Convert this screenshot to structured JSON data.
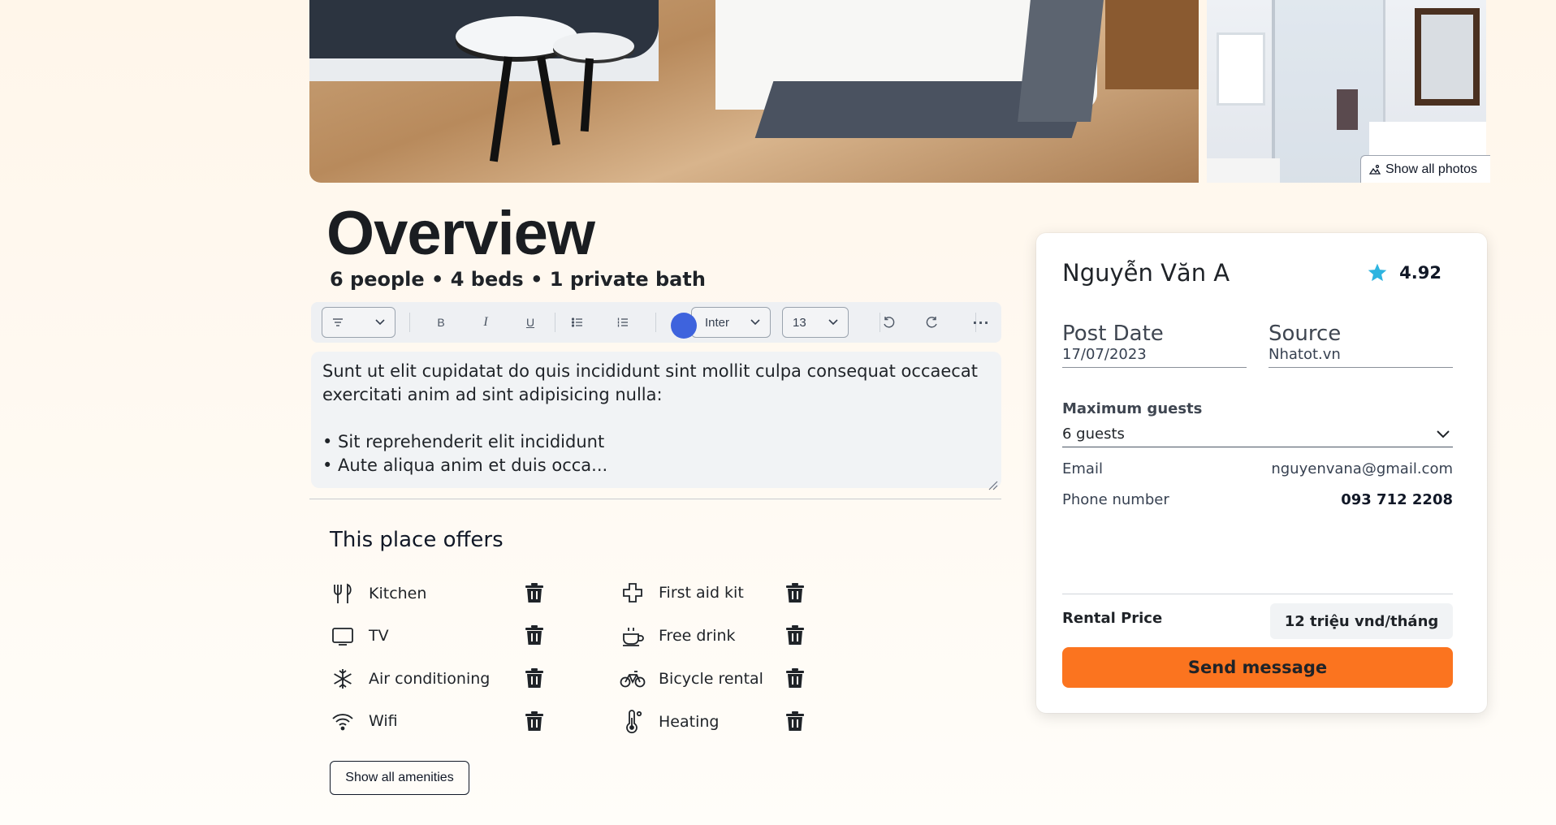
{
  "gallery": {
    "show_all_photos_label": "Show all photos"
  },
  "overview": {
    "title": "Overview",
    "subtitle": "6 people • 4 beds • 1 private bath"
  },
  "toolbar": {
    "font_family": "Inter",
    "font_size": "13"
  },
  "editor": {
    "content": "Sunt ut elit cupidatat do quis incididunt sint mollit culpa consequat occaecat exercitati anim ad sint adipisicing nulla:\n\n• Sit reprehenderit elit incididunt\n• Aute aliqua anim et duis occa..."
  },
  "amenities": {
    "title": "This place offers",
    "items": [
      {
        "label": "Kitchen",
        "icon": "utensils-icon"
      },
      {
        "label": "First aid kit",
        "icon": "first-aid-icon"
      },
      {
        "label": "TV",
        "icon": "tv-icon"
      },
      {
        "label": "Free drink",
        "icon": "coffee-icon"
      },
      {
        "label": "Air conditioning",
        "icon": "snowflake-icon"
      },
      {
        "label": "Bicycle rental",
        "icon": "bicycle-icon"
      },
      {
        "label": "Wifi",
        "icon": "wifi-icon"
      },
      {
        "label": "Heating",
        "icon": "thermometer-icon"
      }
    ],
    "show_all_label": "Show all amenities"
  },
  "host": {
    "name": "Nguyễn Văn A",
    "rating": "4.92",
    "post_date_label": "Post Date",
    "post_date": "17/07/2023",
    "source_label": "Source",
    "source": "Nhatot.vn",
    "max_guests_label": "Maximum guests",
    "max_guests_value": "6 guests",
    "email_label": "Email",
    "email": "nguyenvana@gmail.com",
    "phone_label": "Phone number",
    "phone": "093 712 2208",
    "price_label": "Rental Price",
    "price": "12 triệu vnd/tháng",
    "send_label": "Send message"
  },
  "colors": {
    "accent": "#fb741f",
    "star": "#2eb4e0",
    "toolbar_dot": "#3e63dd"
  }
}
